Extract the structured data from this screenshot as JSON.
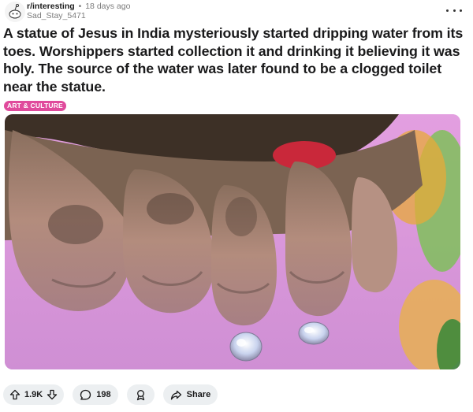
{
  "post": {
    "subreddit": "r/interesting",
    "separator": "•",
    "age": "18 days ago",
    "author": "Sad_Stay_5471",
    "title": "A statue of Jesus in India mysteriously started dripping water from its toes. Worshippers started collection it and drinking it believing it was holy. The source of the water was later found to be a clogged toilet near the statue.",
    "flair": "ART & CULTURE",
    "flair_color": "#e04a9c"
  },
  "actions": {
    "upvote_icon": "arrow-up-icon",
    "score": "1.9K",
    "downvote_icon": "arrow-down-icon",
    "comment_icon": "comment-bubble-icon",
    "comments": "198",
    "award_icon": "award-icon",
    "share_icon": "share-arrow-icon",
    "share_label": "Share"
  },
  "menu_icon": "more-horizontal-icon"
}
